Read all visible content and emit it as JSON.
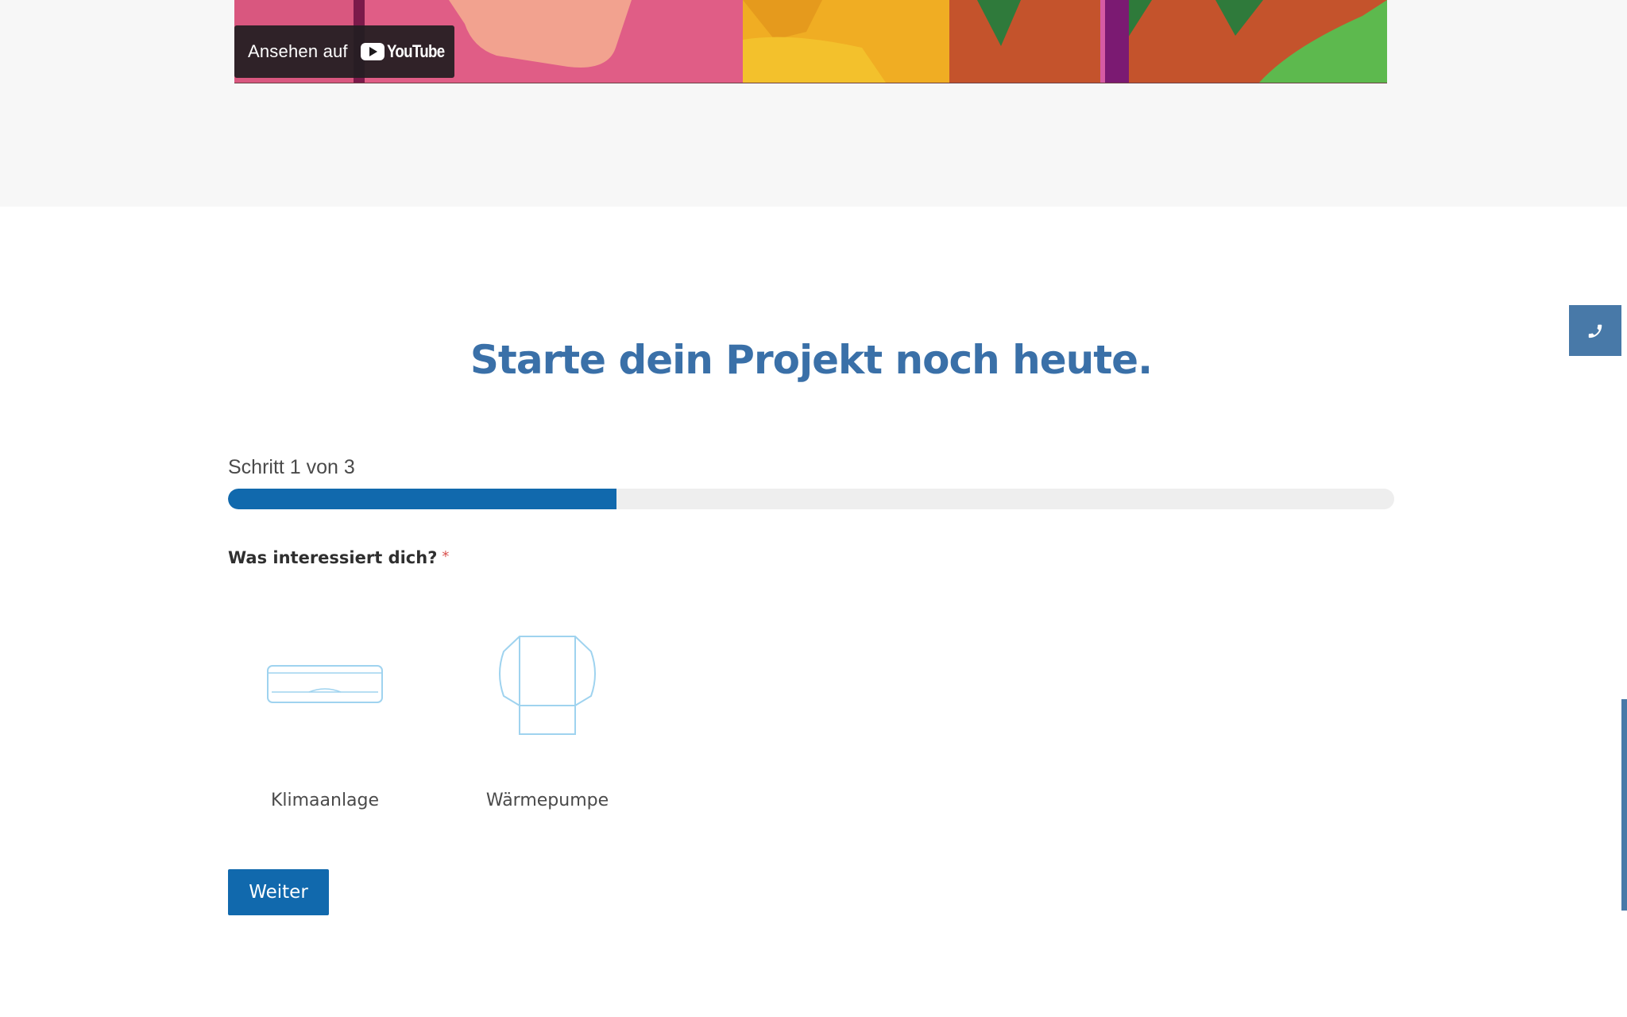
{
  "video": {
    "watch_on_label": "Ansehen auf",
    "brand_label": "YouTube"
  },
  "form": {
    "heading": "Starte dein Projekt noch heute.",
    "step_text": "Schritt 1 von 3",
    "progress": 0.333,
    "question": "Was interessiert dich?",
    "required_marker": "*",
    "options": [
      {
        "label": "Klimaanlage",
        "icon": "air-conditioner-icon"
      },
      {
        "label": "Wärmepumpe",
        "icon": "heat-pump-icon"
      }
    ],
    "next_label": "Weiter"
  },
  "floating": {
    "phone_icon": "phone-icon"
  },
  "colors": {
    "heading": "#3a70a8",
    "primary": "#1169ad",
    "progress_track": "#eeeeee",
    "side_tab": "#4879a8",
    "icon_stroke": "#9fd3ef"
  }
}
